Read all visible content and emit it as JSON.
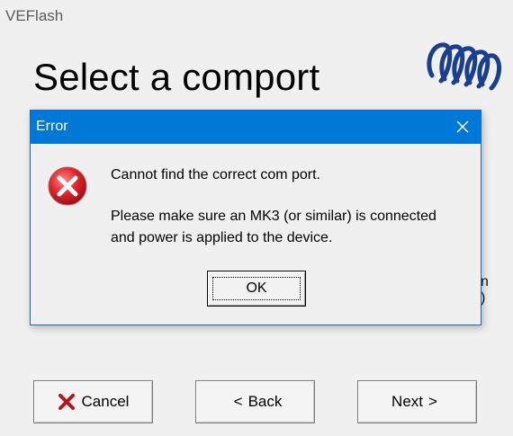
{
  "window": {
    "title": "VEFlash",
    "heading": "Select a comport",
    "logo": "victron-logo",
    "edge_text_1": "n",
    "edge_text_2": ")"
  },
  "buttons": {
    "cancel": {
      "label": "Cancel",
      "icon": "red-x-icon"
    },
    "back": {
      "label": "Back",
      "icon": "chevron-left"
    },
    "next": {
      "label": "Next",
      "icon": "chevron-right"
    }
  },
  "dialog": {
    "title": "Error",
    "icon": "error-icon",
    "close_icon": "close-icon",
    "message_line_1": "Cannot find the correct com port.",
    "message_line_2": "Please make sure an MK3 (or similar) is connected",
    "message_line_3": "and power is applied to the device.",
    "ok_label": "OK"
  },
  "colors": {
    "dialog_title_bar": "#0078d7",
    "error_red": "#d32f2f",
    "logo_blue": "#1b3f8f",
    "window_bg": "#f0f0f0"
  }
}
